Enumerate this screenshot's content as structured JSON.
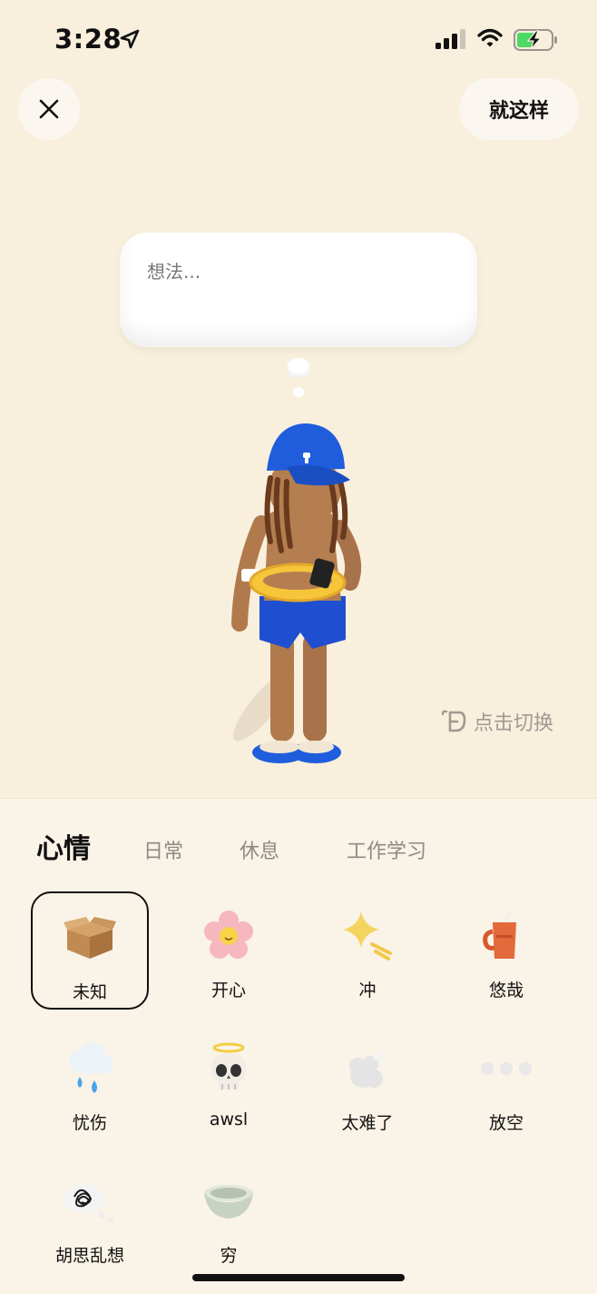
{
  "status_bar": {
    "time": "3:28"
  },
  "header": {
    "done_label": "就这样"
  },
  "thought": {
    "placeholder": "想法..."
  },
  "switch_hint": {
    "label": "点击切换"
  },
  "tabs": [
    {
      "label": "心情"
    },
    {
      "label": "日常"
    },
    {
      "label": "休息"
    },
    {
      "label": "工作学习"
    }
  ],
  "moods": [
    {
      "label": "未知",
      "icon": "box-icon"
    },
    {
      "label": "开心",
      "icon": "flower-icon"
    },
    {
      "label": "冲",
      "icon": "sparkle-icon"
    },
    {
      "label": "悠哉",
      "icon": "mug-icon"
    },
    {
      "label": "忧伤",
      "icon": "rain-cloud-icon"
    },
    {
      "label": "awsl",
      "icon": "skull-halo-icon"
    },
    {
      "label": "太难了",
      "icon": "smoke-puff-icon"
    },
    {
      "label": "放空",
      "icon": "dots-icon"
    },
    {
      "label": "胡思乱想",
      "icon": "tangled-thought-icon"
    },
    {
      "label": "穷",
      "icon": "empty-bowl-icon"
    }
  ],
  "colors": {
    "background": "#f9efdd",
    "panel": "#faf3e7",
    "cap_blue": "#1f5ddc",
    "hint_gray": "#a09a92"
  }
}
